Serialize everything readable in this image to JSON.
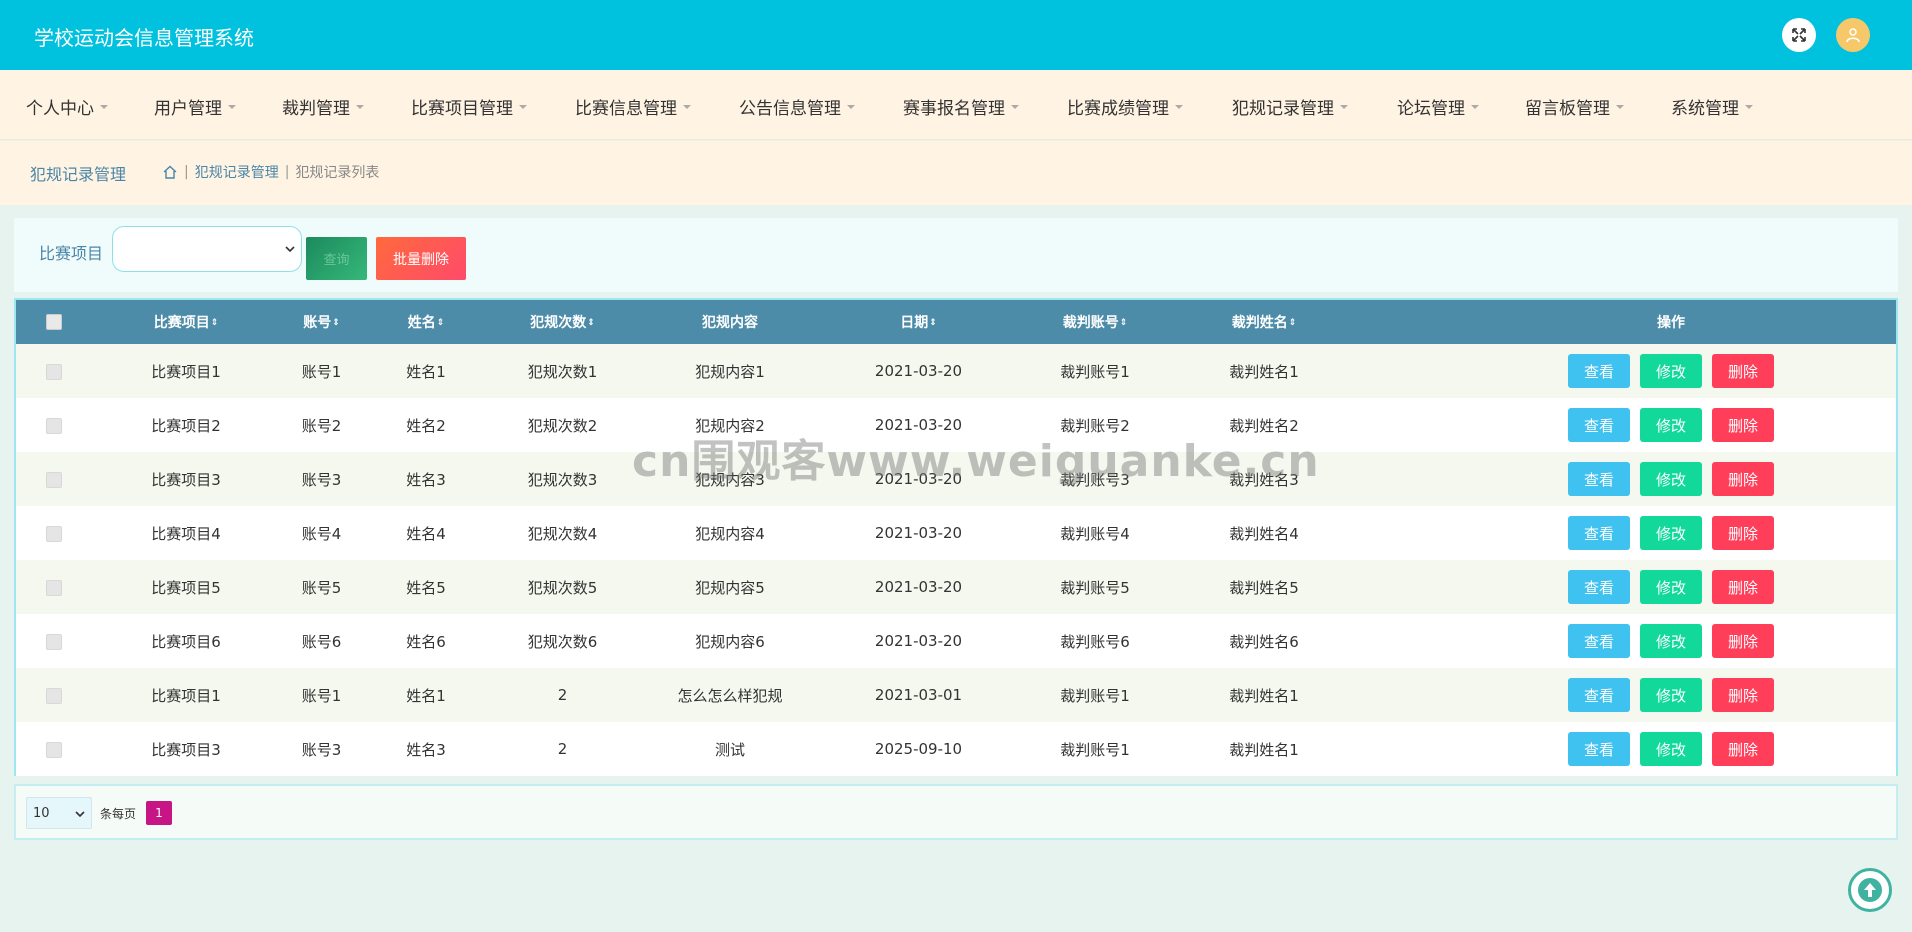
{
  "app": {
    "title": "学校运动会信息管理系统"
  },
  "topbar": {
    "fullscreen_icon": "expand-icon",
    "user_icon": "user-icon"
  },
  "nav": {
    "items": [
      {
        "label": "个人中心"
      },
      {
        "label": "用户管理"
      },
      {
        "label": "裁判管理"
      },
      {
        "label": "比赛项目管理"
      },
      {
        "label": "比赛信息管理"
      },
      {
        "label": "公告信息管理"
      },
      {
        "label": "赛事报名管理"
      },
      {
        "label": "比赛成绩管理"
      },
      {
        "label": "犯规记录管理"
      },
      {
        "label": "论坛管理"
      },
      {
        "label": "留言板管理"
      },
      {
        "label": "系统管理"
      }
    ]
  },
  "breadcrumb": {
    "title": "犯规记录管理",
    "path": [
      "犯规记录管理",
      "犯规记录列表"
    ],
    "home_icon": "home-icon"
  },
  "search": {
    "label": "比赛项目",
    "select_value": "",
    "query_label": "查询",
    "batch_delete_label": "批量删除"
  },
  "table": {
    "columns": [
      "比赛项目",
      "账号",
      "姓名",
      "犯规次数",
      "犯规内容",
      "日期",
      "裁判账号",
      "裁判姓名",
      "操作"
    ],
    "sortable": [
      true,
      true,
      true,
      true,
      false,
      true,
      true,
      true,
      false
    ],
    "rows": [
      [
        "比赛项目1",
        "账号1",
        "姓名1",
        "犯规次数1",
        "犯规内容1",
        "2021-03-20",
        "裁判账号1",
        "裁判姓名1"
      ],
      [
        "比赛项目2",
        "账号2",
        "姓名2",
        "犯规次数2",
        "犯规内容2",
        "2021-03-20",
        "裁判账号2",
        "裁判姓名2"
      ],
      [
        "比赛项目3",
        "账号3",
        "姓名3",
        "犯规次数3",
        "犯规内容3",
        "2021-03-20",
        "裁判账号3",
        "裁判姓名3"
      ],
      [
        "比赛项目4",
        "账号4",
        "姓名4",
        "犯规次数4",
        "犯规内容4",
        "2021-03-20",
        "裁判账号4",
        "裁判姓名4"
      ],
      [
        "比赛项目5",
        "账号5",
        "姓名5",
        "犯规次数5",
        "犯规内容5",
        "2021-03-20",
        "裁判账号5",
        "裁判姓名5"
      ],
      [
        "比赛项目6",
        "账号6",
        "姓名6",
        "犯规次数6",
        "犯规内容6",
        "2021-03-20",
        "裁判账号6",
        "裁判姓名6"
      ],
      [
        "比赛项目1",
        "账号1",
        "姓名1",
        "2",
        "怎么怎么样犯规",
        "2021-03-01",
        "裁判账号1",
        "裁判姓名1"
      ],
      [
        "比赛项目3",
        "账号3",
        "姓名3",
        "2",
        "测试",
        "2025-09-10",
        "裁判账号1",
        "裁判姓名1"
      ]
    ],
    "actions": {
      "view": "查看",
      "edit": "修改",
      "delete": "删除"
    }
  },
  "pagination": {
    "page_size": "10",
    "page_size_label": "条每页",
    "current_page": "1"
  },
  "watermark": "cn围观客www.weiguanke.cn",
  "colors": {
    "topbar": "#00c1de",
    "navbar": "#fff3e3",
    "table_header": "#4d8ca9",
    "view_button": "#3fc2f0",
    "edit_button": "#12d99a",
    "delete_button": "#ff3f5a",
    "active_page": "#c71585"
  }
}
